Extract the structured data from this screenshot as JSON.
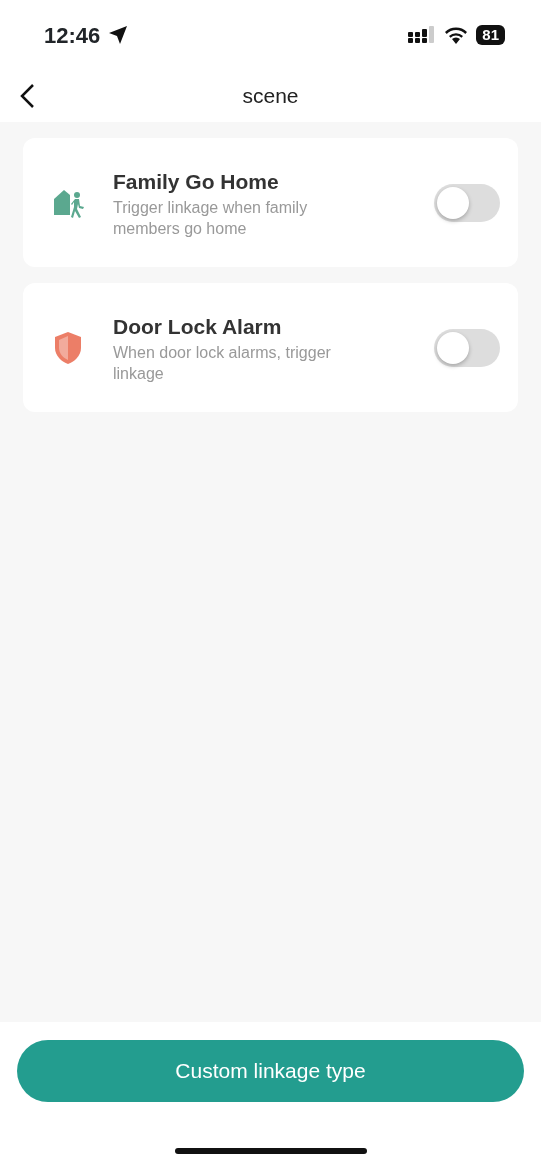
{
  "status_bar": {
    "time": "12:46",
    "battery": "81"
  },
  "nav": {
    "title": "scene"
  },
  "scenes": [
    {
      "kind": "home",
      "title": "Family Go Home",
      "description": "Trigger linkage when family members go home",
      "on": false
    },
    {
      "kind": "shield",
      "title": "Door Lock Alarm",
      "description": "When door lock alarms, trigger linkage",
      "on": false
    }
  ],
  "action_button": "Custom linkage type"
}
